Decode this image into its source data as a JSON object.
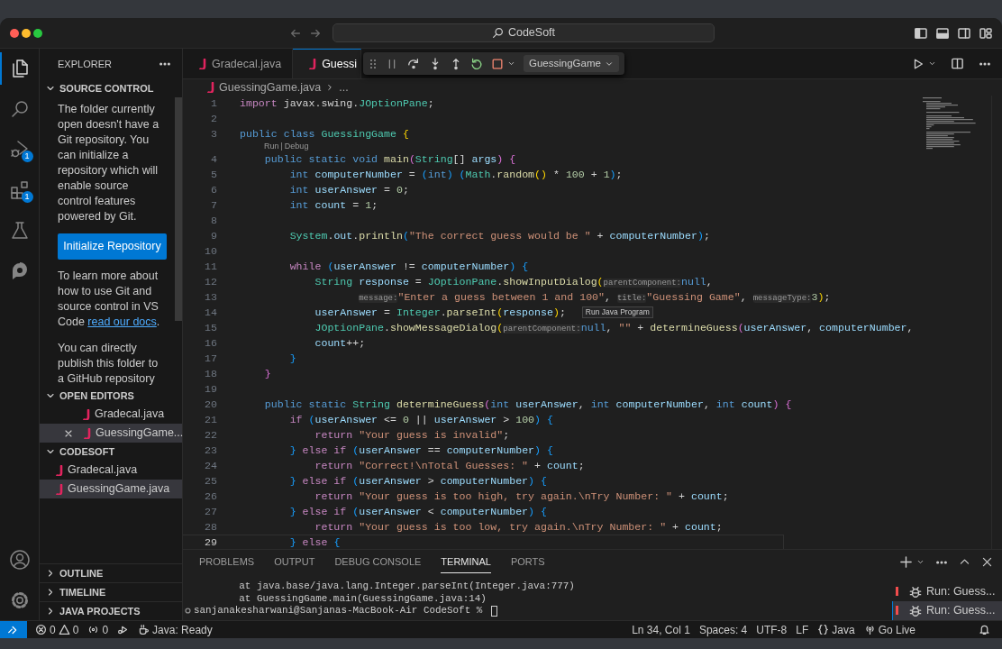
{
  "window": {
    "title": "CodeSoft"
  },
  "activity_bar": [
    {
      "kind": "files",
      "selected": true
    },
    {
      "kind": "search",
      "selected": false
    },
    {
      "kind": "debug",
      "selected": false,
      "badge": "1"
    },
    {
      "kind": "extensions",
      "selected": false,
      "badge": "1"
    },
    {
      "kind": "testing",
      "selected": false
    },
    {
      "kind": "logo",
      "selected": false
    }
  ],
  "sidebar": {
    "title": "EXPLORER",
    "source_control": {
      "title": "SOURCE CONTROL",
      "expanded": true,
      "intro": "The folder currently open doesn't have a Git repository. You can initialize a repository which will enable source control features powered by Git.",
      "button": "Initialize Repository",
      "learn_before": "To learn more about how to use Git and source control in VS Code ",
      "learn_link": "read our docs",
      "learn_after": ".",
      "publish": "You can directly publish this folder to a GitHub repository"
    },
    "open_editors": {
      "title": "OPEN EDITORS",
      "expanded": true,
      "items": [
        {
          "name": "Gradecal.java",
          "selected": false,
          "close_button": false
        },
        {
          "name": "GuessingGame...",
          "selected": true,
          "close_button": true
        }
      ]
    },
    "folder": {
      "title": "CODESOFT",
      "expanded": true,
      "items": [
        {
          "name": "Gradecal.java",
          "selected": false
        },
        {
          "name": "GuessingGame.java",
          "selected": true
        }
      ]
    },
    "collapsed": [
      {
        "title": "OUTLINE",
        "expanded": false
      },
      {
        "title": "TIMELINE",
        "expanded": false
      },
      {
        "title": "JAVA PROJECTS",
        "expanded": false
      }
    ]
  },
  "editor_tabs": [
    {
      "label": "Gradecal.java",
      "selected": false
    },
    {
      "label": "Guessi",
      "selected": true
    }
  ],
  "debug_toolbar": {
    "configuration": "GuessingGame"
  },
  "breadcrumb": {
    "file": "GuessingGame.java",
    "rest": "..."
  },
  "code": [
    {
      "n": "1",
      "current": false,
      "tok": [
        {
          "kind": "ctl",
          "text": "import"
        },
        {
          "kind": "plain",
          "text": " javax.swing."
        },
        {
          "kind": "type",
          "text": "JOptionPane"
        },
        {
          "kind": "plain",
          "text": ";"
        }
      ]
    },
    {
      "n": "2",
      "current": false
    },
    {
      "n": "3",
      "current": false,
      "tok": [
        {
          "kind": "kw",
          "text": "public class "
        },
        {
          "kind": "type",
          "text": "GuessingGame"
        },
        {
          "kind": "br1",
          "text": " {"
        }
      ]
    },
    {
      "kind": "lens",
      "actions": [
        "Run",
        "Debug"
      ],
      "separator": "|"
    },
    {
      "n": "4",
      "current": false,
      "tok": [
        {
          "kind": "kw",
          "text": "    public static void "
        },
        {
          "kind": "fn",
          "text": "main"
        },
        {
          "kind": "br2",
          "text": "("
        },
        {
          "kind": "type",
          "text": "String"
        },
        {
          "kind": "plain",
          "text": "[] "
        },
        {
          "kind": "var",
          "text": "args"
        },
        {
          "kind": "br2",
          "text": ")"
        },
        {
          "kind": "br2",
          "text": " {"
        }
      ]
    },
    {
      "n": "5",
      "current": false,
      "tok": [
        {
          "kind": "kw",
          "text": "        int "
        },
        {
          "kind": "var",
          "text": "computerNumber"
        },
        {
          "kind": "plain",
          "text": " = "
        },
        {
          "kind": "br3",
          "text": "("
        },
        {
          "kind": "kw",
          "text": "int"
        },
        {
          "kind": "br3",
          "text": ")"
        },
        {
          "kind": "br3",
          "text": " ("
        },
        {
          "kind": "type",
          "text": "Math"
        },
        {
          "kind": "plain",
          "text": "."
        },
        {
          "kind": "fn",
          "text": "random"
        },
        {
          "kind": "br1",
          "text": "()"
        },
        {
          "kind": "plain",
          "text": " * "
        },
        {
          "kind": "num",
          "text": "100"
        },
        {
          "kind": "plain",
          "text": " + "
        },
        {
          "kind": "num",
          "text": "1"
        },
        {
          "kind": "br3",
          "text": ")"
        },
        {
          "kind": "plain",
          "text": ";"
        }
      ]
    },
    {
      "n": "6",
      "current": false,
      "tok": [
        {
          "kind": "kw",
          "text": "        int "
        },
        {
          "kind": "var",
          "text": "userAnswer"
        },
        {
          "kind": "plain",
          "text": " = "
        },
        {
          "kind": "num",
          "text": "0"
        },
        {
          "kind": "plain",
          "text": ";"
        }
      ]
    },
    {
      "n": "7",
      "current": false,
      "tok": [
        {
          "kind": "kw",
          "text": "        int "
        },
        {
          "kind": "var",
          "text": "count"
        },
        {
          "kind": "plain",
          "text": " = "
        },
        {
          "kind": "num",
          "text": "1"
        },
        {
          "kind": "plain",
          "text": ";"
        }
      ]
    },
    {
      "n": "8",
      "current": false
    },
    {
      "n": "9",
      "current": false,
      "tok": [
        {
          "kind": "type",
          "text": "        System"
        },
        {
          "kind": "plain",
          "text": "."
        },
        {
          "kind": "var",
          "text": "out"
        },
        {
          "kind": "plain",
          "text": "."
        },
        {
          "kind": "fn",
          "text": "println"
        },
        {
          "kind": "br3",
          "text": "("
        },
        {
          "kind": "str",
          "text": "\"The correct guess would be \""
        },
        {
          "kind": "plain",
          "text": " + "
        },
        {
          "kind": "var",
          "text": "computerNumber"
        },
        {
          "kind": "br3",
          "text": ")"
        },
        {
          "kind": "plain",
          "text": ";"
        }
      ]
    },
    {
      "n": "10",
      "current": false
    },
    {
      "n": "11",
      "current": false,
      "tok": [
        {
          "kind": "ctl",
          "text": "        while"
        },
        {
          "kind": "br3",
          "text": " ("
        },
        {
          "kind": "var",
          "text": "userAnswer"
        },
        {
          "kind": "plain",
          "text": " != "
        },
        {
          "kind": "var",
          "text": "computerNumber"
        },
        {
          "kind": "br3",
          "text": ")"
        },
        {
          "kind": "br3",
          "text": " {"
        }
      ]
    },
    {
      "n": "12",
      "current": false,
      "tok": [
        {
          "kind": "type",
          "text": "            String"
        },
        {
          "kind": "var",
          "text": " response"
        },
        {
          "kind": "plain",
          "text": " = "
        },
        {
          "kind": "type",
          "text": "JOptionPane"
        },
        {
          "kind": "plain",
          "text": "."
        },
        {
          "kind": "fn",
          "text": "showInputDialog"
        },
        {
          "kind": "br1",
          "text": "("
        },
        {
          "kind": "hint",
          "text": "parentComponent:"
        },
        {
          "kind": "kw",
          "text": "null"
        },
        {
          "kind": "plain",
          "text": ","
        }
      ]
    },
    {
      "n": "13",
      "current": false,
      "tok": [
        {
          "kind": "hint",
          "text": "                   message:"
        },
        {
          "kind": "str",
          "text": "\"Enter a guess between 1 and 100\""
        },
        {
          "kind": "plain",
          "text": ", "
        },
        {
          "kind": "hint",
          "text": "title:"
        },
        {
          "kind": "str",
          "text": "\"Guessing Game\""
        },
        {
          "kind": "plain",
          "text": ", "
        },
        {
          "kind": "hint",
          "text": "messageType:"
        },
        {
          "kind": "num",
          "text": "3"
        },
        {
          "kind": "br1",
          "text": ")"
        },
        {
          "kind": "plain",
          "text": ";"
        }
      ]
    },
    {
      "n": "14",
      "current": false,
      "tooltip": "Run Java Program",
      "tok": [
        {
          "kind": "var",
          "text": "            userAnswer"
        },
        {
          "kind": "plain",
          "text": " = "
        },
        {
          "kind": "type",
          "text": "Integer"
        },
        {
          "kind": "plain",
          "text": "."
        },
        {
          "kind": "fn",
          "text": "parseInt"
        },
        {
          "kind": "br1",
          "text": "("
        },
        {
          "kind": "var",
          "text": "response"
        },
        {
          "kind": "br1",
          "text": ")"
        },
        {
          "kind": "plain",
          "text": ";"
        }
      ]
    },
    {
      "n": "15",
      "current": false,
      "tok": [
        {
          "kind": "type",
          "text": "            JOptionPane"
        },
        {
          "kind": "plain",
          "text": "."
        },
        {
          "kind": "fn",
          "text": "showMessageDialog"
        },
        {
          "kind": "br1",
          "text": "("
        },
        {
          "kind": "hint",
          "text": "parentComponent:"
        },
        {
          "kind": "kw",
          "text": "null"
        },
        {
          "kind": "plain",
          "text": ", "
        },
        {
          "kind": "str",
          "text": "\"\""
        },
        {
          "kind": "plain",
          "text": " + "
        },
        {
          "kind": "fn",
          "text": "determineGuess"
        },
        {
          "kind": "br2",
          "text": "("
        },
        {
          "kind": "var",
          "text": "userAnswer"
        },
        {
          "kind": "plain",
          "text": ", "
        },
        {
          "kind": "var",
          "text": "computerNumber"
        },
        {
          "kind": "plain",
          "text": ","
        }
      ]
    },
    {
      "n": "16",
      "current": false,
      "tok": [
        {
          "kind": "var",
          "text": "            count"
        },
        {
          "kind": "plain",
          "text": "++;"
        }
      ]
    },
    {
      "n": "17",
      "current": false,
      "tok": [
        {
          "kind": "br3",
          "text": "        }"
        }
      ]
    },
    {
      "n": "18",
      "current": false,
      "tok": [
        {
          "kind": "br2",
          "text": "    }"
        }
      ]
    },
    {
      "n": "19",
      "current": false
    },
    {
      "n": "20",
      "current": false,
      "tok": [
        {
          "kind": "kw",
          "text": "    public static "
        },
        {
          "kind": "type",
          "text": "String"
        },
        {
          "kind": "fn",
          "text": " determineGuess"
        },
        {
          "kind": "br2",
          "text": "("
        },
        {
          "kind": "kw",
          "text": "int "
        },
        {
          "kind": "var",
          "text": "userAnswer"
        },
        {
          "kind": "plain",
          "text": ", "
        },
        {
          "kind": "kw",
          "text": "int "
        },
        {
          "kind": "var",
          "text": "computerNumber"
        },
        {
          "kind": "plain",
          "text": ", "
        },
        {
          "kind": "kw",
          "text": "int "
        },
        {
          "kind": "var",
          "text": "count"
        },
        {
          "kind": "br2",
          "text": ")"
        },
        {
          "kind": "br2",
          "text": " {"
        }
      ]
    },
    {
      "n": "21",
      "current": false,
      "tok": [
        {
          "kind": "ctl",
          "text": "        if"
        },
        {
          "kind": "br3",
          "text": " ("
        },
        {
          "kind": "var",
          "text": "userAnswer"
        },
        {
          "kind": "plain",
          "text": " <= "
        },
        {
          "kind": "num",
          "text": "0"
        },
        {
          "kind": "plain",
          "text": " || "
        },
        {
          "kind": "var",
          "text": "userAnswer"
        },
        {
          "kind": "plain",
          "text": " > "
        },
        {
          "kind": "num",
          "text": "100"
        },
        {
          "kind": "br3",
          "text": ")"
        },
        {
          "kind": "br3",
          "text": " {"
        }
      ]
    },
    {
      "n": "22",
      "current": false,
      "tok": [
        {
          "kind": "ctl",
          "text": "            return"
        },
        {
          "kind": "str",
          "text": " \"Your guess is invalid\""
        },
        {
          "kind": "plain",
          "text": ";"
        }
      ]
    },
    {
      "n": "23",
      "current": false,
      "tok": [
        {
          "kind": "br3",
          "text": "        }"
        },
        {
          "kind": "ctl",
          "text": " else if"
        },
        {
          "kind": "br3",
          "text": " ("
        },
        {
          "kind": "var",
          "text": "userAnswer"
        },
        {
          "kind": "plain",
          "text": " == "
        },
        {
          "kind": "var",
          "text": "computerNumber"
        },
        {
          "kind": "br3",
          "text": ")"
        },
        {
          "kind": "br3",
          "text": " {"
        }
      ]
    },
    {
      "n": "24",
      "current": false,
      "tok": [
        {
          "kind": "ctl",
          "text": "            return"
        },
        {
          "kind": "str",
          "text": " \"Correct!\\nTotal Guesses: \""
        },
        {
          "kind": "plain",
          "text": " + "
        },
        {
          "kind": "var",
          "text": "count"
        },
        {
          "kind": "plain",
          "text": ";"
        }
      ]
    },
    {
      "n": "25",
      "current": false,
      "tok": [
        {
          "kind": "br3",
          "text": "        }"
        },
        {
          "kind": "ctl",
          "text": " else if"
        },
        {
          "kind": "br3",
          "text": " ("
        },
        {
          "kind": "var",
          "text": "userAnswer"
        },
        {
          "kind": "plain",
          "text": " > "
        },
        {
          "kind": "var",
          "text": "computerNumber"
        },
        {
          "kind": "br3",
          "text": ")"
        },
        {
          "kind": "br3",
          "text": " {"
        }
      ]
    },
    {
      "n": "26",
      "current": false,
      "tok": [
        {
          "kind": "ctl",
          "text": "            return"
        },
        {
          "kind": "str",
          "text": " \"Your guess is too high, try again.\\nTry Number: \""
        },
        {
          "kind": "plain",
          "text": " + "
        },
        {
          "kind": "var",
          "text": "count"
        },
        {
          "kind": "plain",
          "text": ";"
        }
      ]
    },
    {
      "n": "27",
      "current": false,
      "tok": [
        {
          "kind": "br3",
          "text": "        }"
        },
        {
          "kind": "ctl",
          "text": " else if"
        },
        {
          "kind": "br3",
          "text": " ("
        },
        {
          "kind": "var",
          "text": "userAnswer"
        },
        {
          "kind": "plain",
          "text": " < "
        },
        {
          "kind": "var",
          "text": "computerNumber"
        },
        {
          "kind": "br3",
          "text": ")"
        },
        {
          "kind": "br3",
          "text": " {"
        }
      ]
    },
    {
      "n": "28",
      "current": false,
      "tok": [
        {
          "kind": "ctl",
          "text": "            return"
        },
        {
          "kind": "str",
          "text": " \"Your guess is too low, try again.\\nTry Number: \""
        },
        {
          "kind": "plain",
          "text": " + "
        },
        {
          "kind": "var",
          "text": "count"
        },
        {
          "kind": "plain",
          "text": ";"
        }
      ]
    },
    {
      "n": "29",
      "current": true,
      "tok": [
        {
          "kind": "br3",
          "text": "        }"
        },
        {
          "kind": "ctl",
          "text": " else"
        },
        {
          "kind": "br3",
          "text": " {"
        }
      ]
    }
  ],
  "panel": {
    "tabs": [
      {
        "label": "PROBLEMS",
        "selected": false
      },
      {
        "label": "OUTPUT",
        "selected": false
      },
      {
        "label": "DEBUG CONSOLE",
        "selected": false
      },
      {
        "label": "TERMINAL",
        "selected": true
      },
      {
        "label": "PORTS",
        "selected": false
      }
    ],
    "terminal_lines": [
      "        at java.base/java.lang.Integer.parseInt(Integer.java:777)",
      "        at GuessingGame.main(GuessingGame.java:14)"
    ],
    "prompt": "sanjanakesharwani@Sanjanas-MacBook-Air CodeSoft % ",
    "terminals": [
      {
        "label": "Run: Guess...",
        "selected": false
      },
      {
        "label": "Run: Guess...",
        "selected": true
      }
    ]
  },
  "status_bar": {
    "errors": "0",
    "warnings": "0",
    "ports": "0",
    "java_status": "Java: Ready",
    "position": "Ln 34, Col 1",
    "indentation": "Spaces: 4",
    "encoding": "UTF-8",
    "line_ending": "LF",
    "language": "Java",
    "live_server": "Go Live"
  }
}
